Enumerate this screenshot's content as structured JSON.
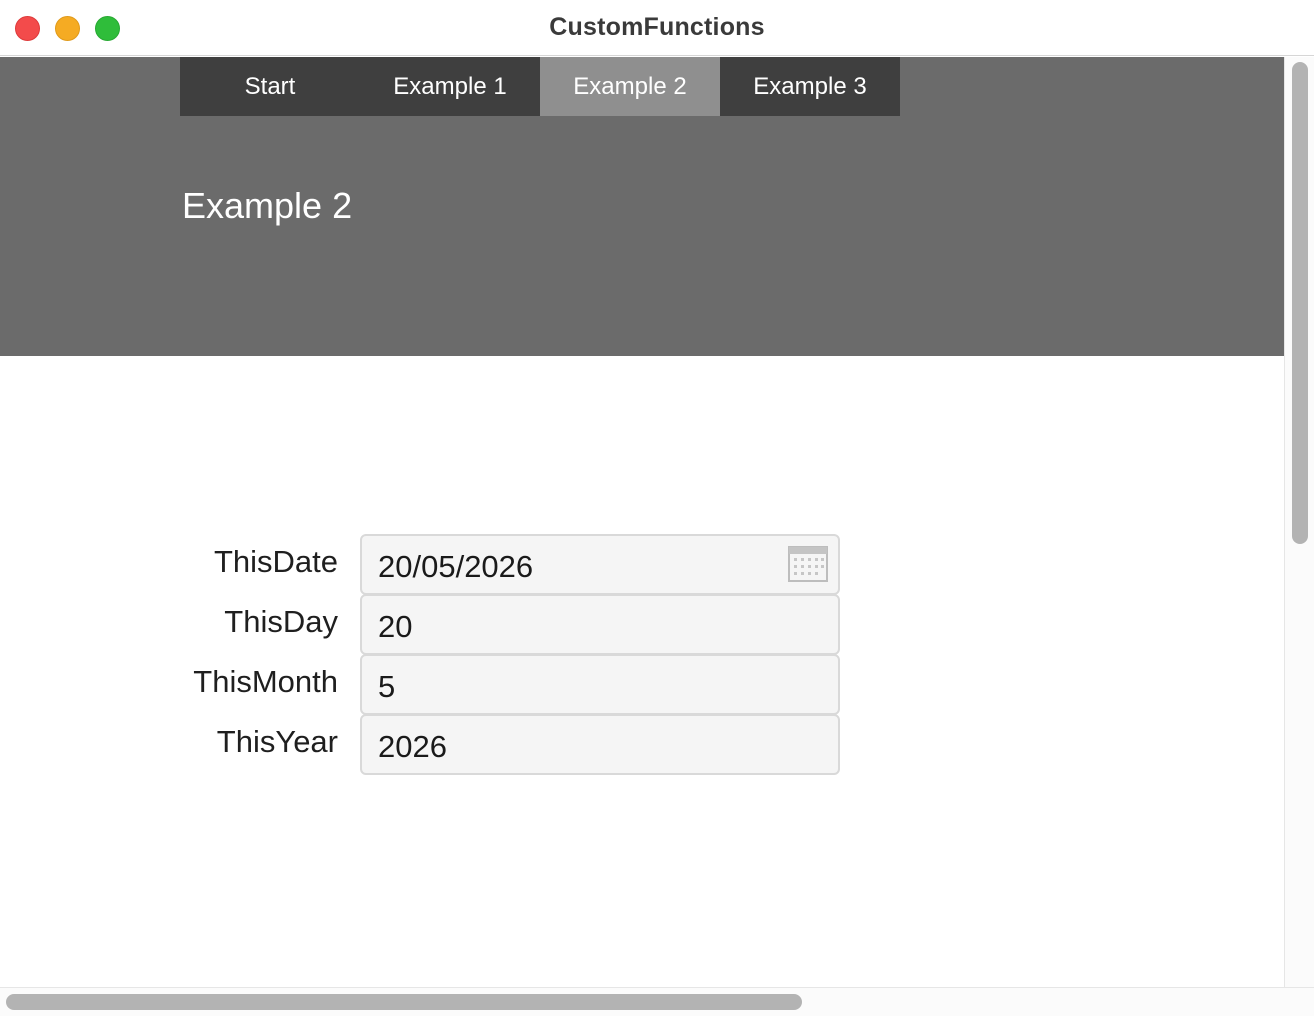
{
  "window": {
    "title": "CustomFunctions",
    "controls": [
      "close",
      "minimize",
      "zoom"
    ]
  },
  "nav": {
    "tabs": [
      {
        "label": "Start",
        "active": false
      },
      {
        "label": "Example 1",
        "active": false
      },
      {
        "label": "Example 2",
        "active": true
      },
      {
        "label": "Example 3",
        "active": false
      }
    ]
  },
  "page": {
    "heading": "Example 2"
  },
  "form": {
    "fields": [
      {
        "label": "ThisDate",
        "value": "20/05/2026",
        "icon": "calendar-icon"
      },
      {
        "label": "ThisDay",
        "value": "20"
      },
      {
        "label": "ThisMonth",
        "value": "5"
      },
      {
        "label": "ThisYear",
        "value": "2026"
      }
    ]
  },
  "colors": {
    "header_band": "#6b6b6b",
    "tab_bg": "#3f3f3f",
    "tab_active_bg": "#8f8f8f",
    "field_bg": "#f5f5f5",
    "close": "#f34b4b",
    "minimize": "#f5ab23",
    "zoom": "#2fbd3a"
  }
}
